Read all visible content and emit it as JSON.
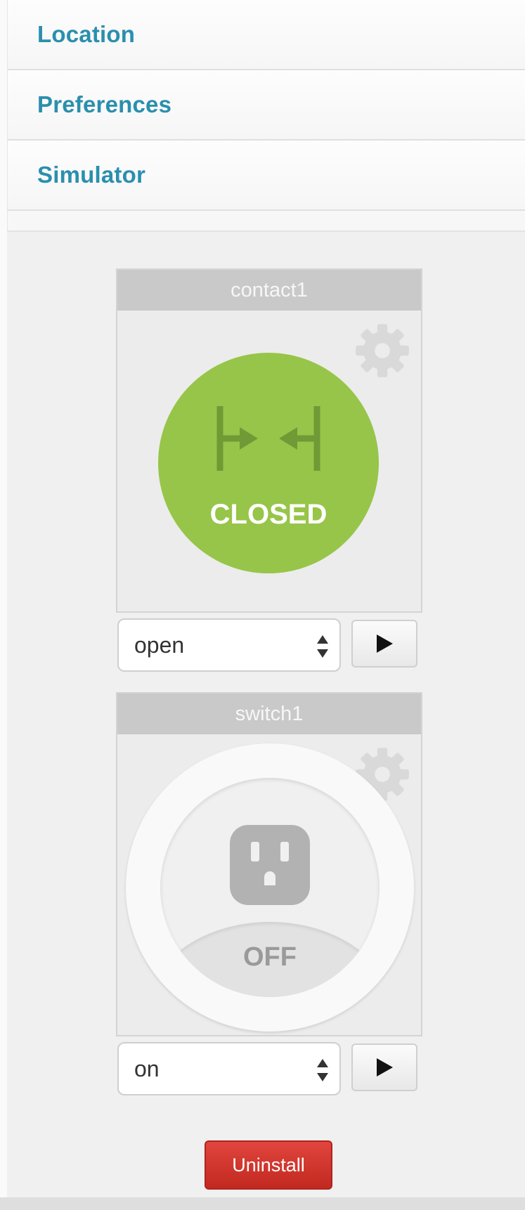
{
  "accordion": {
    "items": [
      {
        "label": "Location"
      },
      {
        "label": "Preferences"
      },
      {
        "label": "Simulator"
      }
    ]
  },
  "devices": {
    "contact": {
      "name": "contact1",
      "state": "CLOSED",
      "state_color": "#97c549",
      "icon": "contact-closed-icon",
      "select_value": "open"
    },
    "switch": {
      "name": "switch1",
      "state": "OFF",
      "icon": "outlet-icon",
      "select_value": "on"
    }
  },
  "actions": {
    "uninstall_label": "Uninstall",
    "uninstall_color": "#d1342c"
  },
  "colors": {
    "accent": "#2a8fae"
  }
}
